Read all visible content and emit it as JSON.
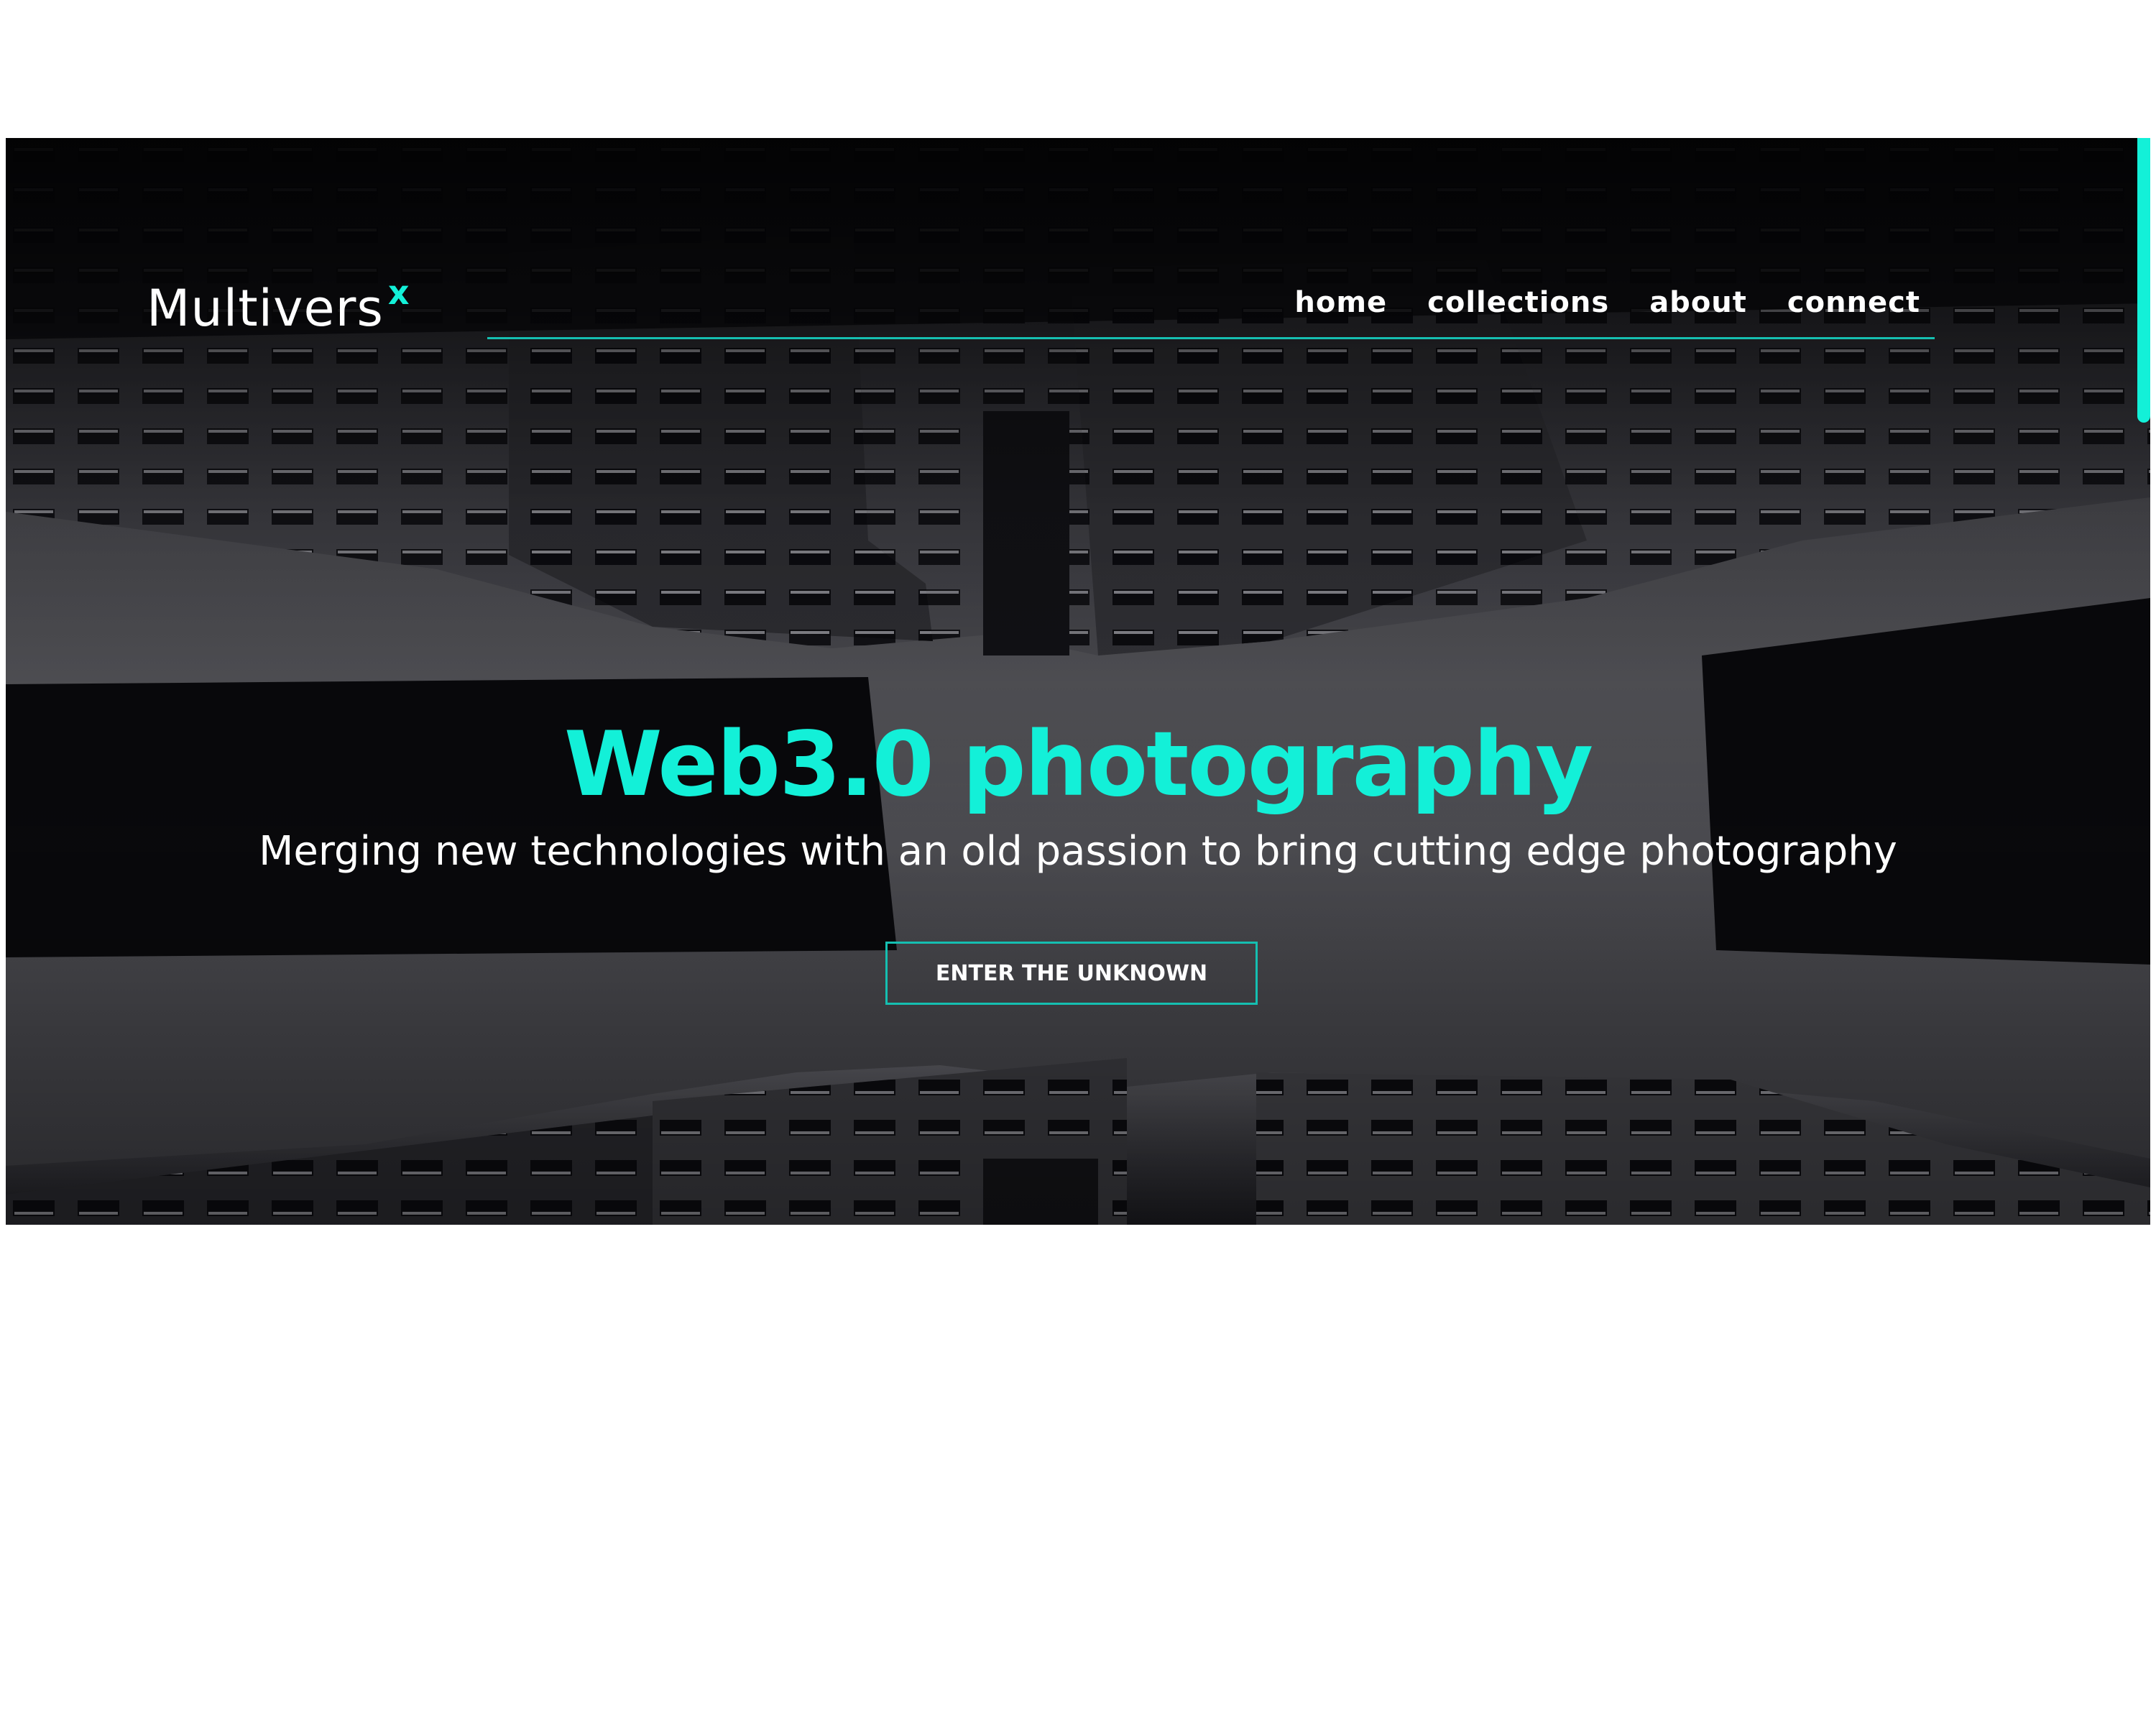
{
  "header": {
    "logo_text": "Multivers",
    "logo_mark": "x",
    "nav": [
      "home",
      "collections",
      "about",
      "connect"
    ]
  },
  "hero": {
    "title": "Web3.0 photography",
    "subtitle": "Merging new technologies with an old passion to bring cutting edge photography",
    "cta_label": "ENTER THE UNKNOWN",
    "background": "upward-view-of-buildings-photo"
  },
  "colors": {
    "accent": "#13f0d8",
    "accent_line": "#15bfb1",
    "background": "#07070b",
    "text": "#ffffff"
  }
}
